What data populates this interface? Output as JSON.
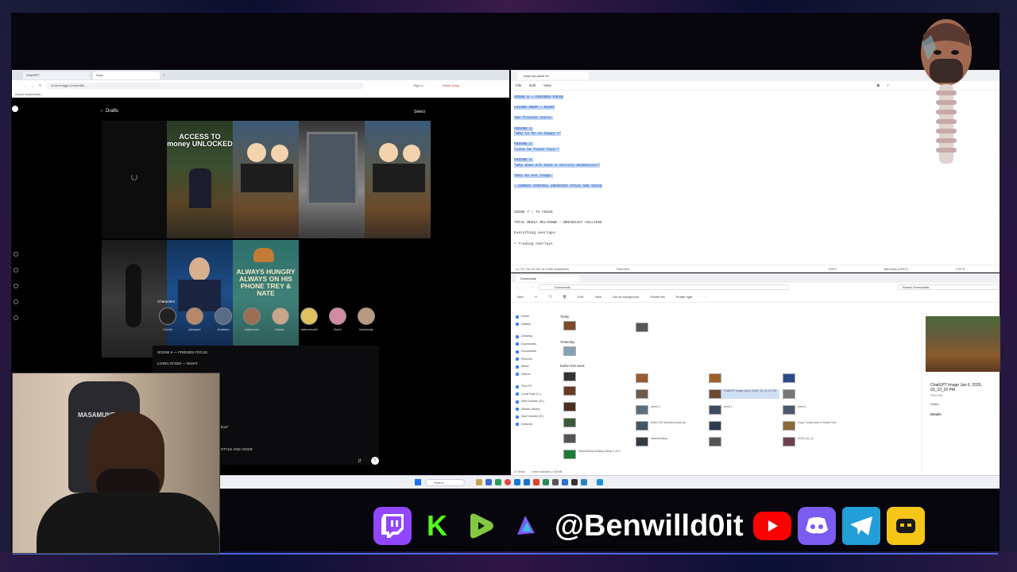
{
  "browser": {
    "tabs": [
      {
        "label": "ChatGPT"
      },
      {
        "label": "Sora"
      }
    ],
    "url": "sora.chatgpt.com/drafts",
    "sign_in": "Sign in",
    "finish_setup": "Finish setup",
    "bookmarks": "Import bookmarks..."
  },
  "sora": {
    "header": "Drafts",
    "select_label": "Select",
    "tiles": [
      {
        "label": "ACCESS TO money UNLOCKED"
      },
      {
        "label": "ALWAYS HUNGRY ALWAYS ON HIS PHONE TREY & NATE"
      }
    ],
    "characters_title": "Characters",
    "characters": [
      {
        "name": "Create"
      },
      {
        "name": "jakepaul"
      },
      {
        "name": "sinatabs"
      },
      {
        "name": "raybenson"
      },
      {
        "name": "rickyte..."
      },
      {
        "name": "dabreelcraft"
      },
      {
        "name": "t3ze2"
      },
      {
        "name": "kicksleaty"
      }
    ],
    "scene_lines": [
      "SCENE 6 — FRIENDS FOCUS",
      "LIVING ROOM — NIGHT",
      "tion!\"",
      "STYLE AND VOICE"
    ]
  },
  "notepad": {
    "tab_title": "script-ep-pilote.txt",
    "menu": [
      "File",
      "Edit",
      "View"
    ],
    "lines": [
      {
        "text": "SCENE 6 — FRIENDS FOCUS",
        "selected": true
      },
      {
        "text": "",
        "selected": false
      },
      {
        "text": "LIVING ROOM — NIGHT",
        "selected": true
      },
      {
        "text": "",
        "selected": false
      },
      {
        "text": "Two friends stare.",
        "selected": true
      },
      {
        "text": "",
        "selected": false
      },
      {
        "text": "FRIEND 1:",
        "selected": true
      },
      {
        "text": "\"Why is he so happy ?\"",
        "selected": true
      },
      {
        "text": "",
        "selected": false
      },
      {
        "text": "FRIEND 2:",
        "selected": true
      },
      {
        "text": "\"Like he found luck.\"",
        "selected": true
      },
      {
        "text": "",
        "selected": false
      },
      {
        "text": "FRIEND 2:",
        "selected": true
      },
      {
        "text": "\"Why does all have a victory animation?\"",
        "selected": true
      },
      {
        "text": "",
        "selected": false
      },
      {
        "text": "They do not laugh.",
        "selected": true
      },
      {
        "text": "",
        "selected": false
      },
      {
        "text": "— COMEDY CENTRAL ANIMATED STYLE AND VOICE",
        "selected": true
      },
      {
        "text": "",
        "selected": false
      },
      {
        "text": "",
        "selected": false
      },
      {
        "text": "",
        "selected": false
      },
      {
        "text": "",
        "selected": false
      },
      {
        "text": "SCENE 7 — TV FOCUS",
        "selected": false
      },
      {
        "text": "",
        "selected": false
      },
      {
        "text": "TOTAL MEDIA MELTDOWN — BROADCAST COLLAPSE",
        "selected": false
      },
      {
        "text": "",
        "selected": false
      },
      {
        "text": "Everything overlaps:",
        "selected": false
      },
      {
        "text": "",
        "selected": false
      },
      {
        "text": "• Trading overlays",
        "selected": false
      }
    ],
    "status": [
      "Ln 73, Col 42   240 of 3,830 characters",
      "Plain text",
      "100%",
      "Windows (CRLF)",
      "UTF-8"
    ]
  },
  "explorer": {
    "tab_title": "Downloads",
    "path": "Downloads",
    "search_placeholder": "Search Downloads",
    "toolbar": [
      "New",
      "Sort",
      "View",
      "Set as background",
      "Rotate left",
      "Rotate right"
    ],
    "nav": [
      "Home",
      "Gallery",
      "Desktop",
      "Downloads",
      "Documents",
      "Pictures",
      "Music",
      "Videos",
      "This PC",
      "Local Disk (C:)",
      "New Volume (D:)",
      "Steam Library",
      "New Volume (E:)",
      "Network"
    ],
    "groups": [
      "Today",
      "Yesterday",
      "Earlier this week"
    ],
    "files": [
      {
        "name": "ChatGPT Image Jan 6, 2026, 03_23_20 PM",
        "meta": "PNG File"
      },
      {
        "name": "scene 1",
        "meta": "PNG File"
      },
      {
        "name": "fnerd 1",
        "meta": "PNG File"
      },
      {
        "name": "fnerd 2",
        "meta": "PNG File"
      },
      {
        "name": "Robo CAT television close up",
        "meta": "PNG File"
      },
      {
        "name": "Copy Trump room in South Park",
        "meta": "PNG File"
      },
      {
        "name": "steamdesktop",
        "meta": "PNG File"
      },
      {
        "name": "HD20_v6_nz",
        "meta": "PNG File"
      },
      {
        "name": "SteamSetup-Desktop-Setup-1.19.0",
        "meta": "Application"
      }
    ],
    "detail_title": "ChatGPT Image Jan 6, 2026, 03_23_20 PM",
    "detail_sub": "PNG File",
    "detail_share": "Share",
    "detail_heading": "Details",
    "status": [
      "27 items",
      "1 item selected  2.38 MB"
    ]
  },
  "taskbar": {
    "search_label": "Search"
  },
  "stream": {
    "handle": "@Benwilld0it",
    "colors": {
      "twitch": "#9146ff",
      "kick": "#53fc18",
      "youtube": "#ff0000",
      "telegram": "#229ed9",
      "accent": "#4c6bd6"
    },
    "icons": [
      "twitch-icon",
      "kick-icon",
      "rumble-icon",
      "deck-icon",
      "youtube-icon",
      "discord-icon",
      "telegram-icon",
      "bot-icon"
    ],
    "webcam_chair_brand": "MASAMUNE"
  }
}
